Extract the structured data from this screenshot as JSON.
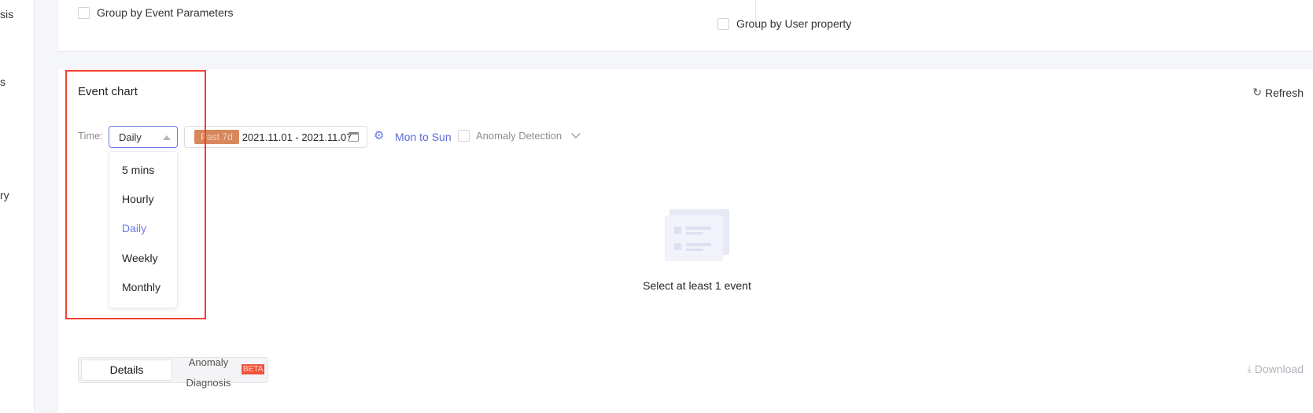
{
  "sidebar": {
    "fragments": [
      "sis",
      "s",
      "ry"
    ]
  },
  "grouping": {
    "event_params_label": "Group by Event Parameters",
    "user_property_label": "Group by User property"
  },
  "chart_panel": {
    "title": "Event chart",
    "refresh_label": "Refresh",
    "time_label": "Time:",
    "granularity": {
      "selected": "Daily",
      "options": [
        "5 mins",
        "Hourly",
        "Daily",
        "Weekly",
        "Monthly"
      ]
    },
    "date_range": {
      "preset_badge": "Past 7d",
      "range_text": "2021.11.01 - 2021.11.07"
    },
    "week_mode": "Mon to Sun",
    "anomaly_detection_label": "Anomaly Detection",
    "empty_state": "Select at least 1 event"
  },
  "result_tabs": {
    "details_label": "Details",
    "anomaly_line1": "Anomaly",
    "anomaly_line2": "Diagnosis",
    "beta_badge": "BETA",
    "download_label": "Download"
  },
  "colors": {
    "accent": "#6c7ae0",
    "badge_bg": "#d8875c",
    "highlight_border": "#f0412e",
    "beta_bg": "#f0533a"
  }
}
